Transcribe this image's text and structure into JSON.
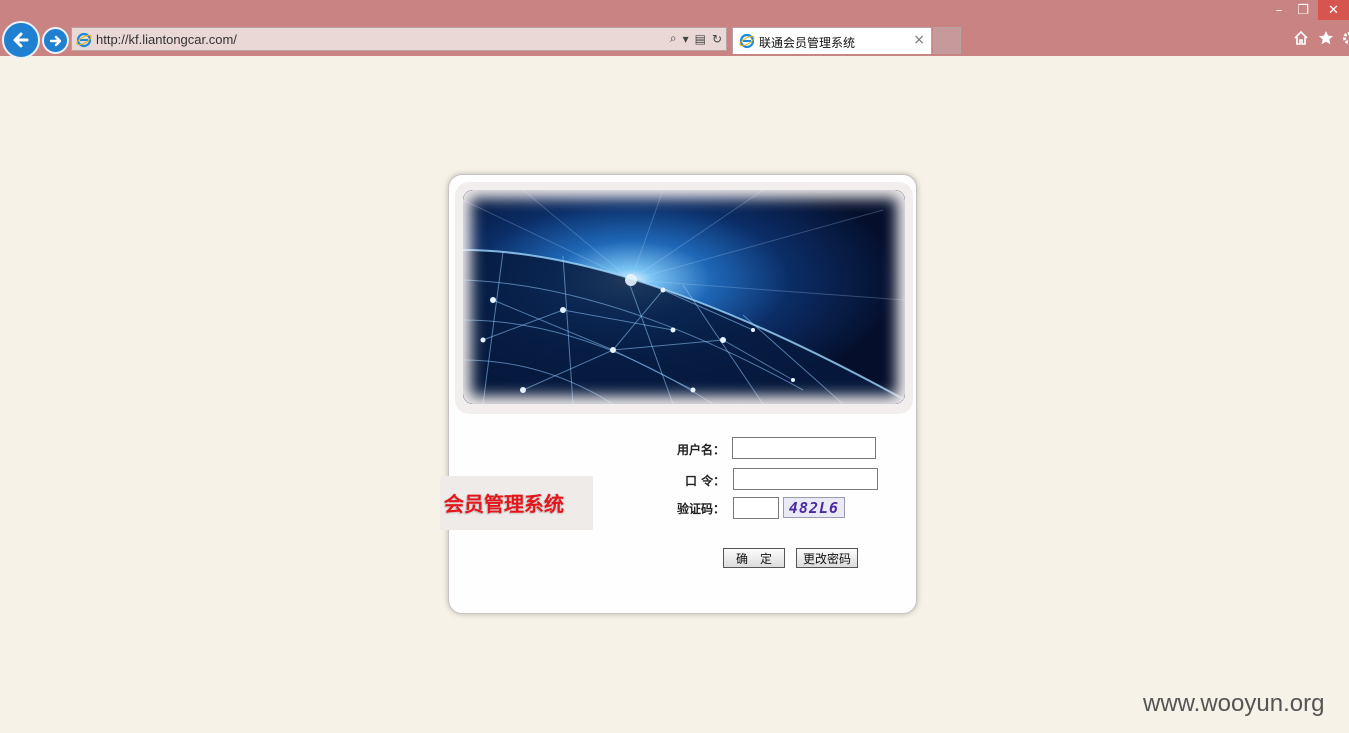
{
  "browser": {
    "url": "http://kf.liantongcar.com/",
    "tab_title": "联通会员管理系统",
    "tab_close": "×",
    "window_controls": {
      "minimize": "–",
      "maximize": "❐",
      "close": "✕"
    },
    "toolbar_icons": [
      "home-icon",
      "star-icon",
      "gear-icon"
    ],
    "accent_color": "#c98383"
  },
  "login": {
    "username_label": "用户名：",
    "password_label": "口 令：",
    "captcha_label": "验证码：",
    "captcha_text": "482L6",
    "confirm_button": "确　定",
    "change_password_button": "更改密码",
    "system_title": "会员管理系统"
  },
  "watermark": "www.wooyun.org"
}
